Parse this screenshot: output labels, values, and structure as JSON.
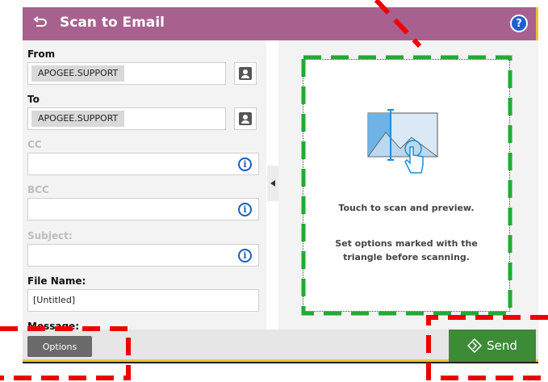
{
  "header": {
    "title": "Scan to Email",
    "help": "?"
  },
  "form": {
    "from_label": "From",
    "from_value": "APOGEE.SUPPORT",
    "to_label": "To",
    "to_value": "APOGEE.SUPPORT",
    "cc_label": "CC",
    "bcc_label": "BCC",
    "subject_label": "Subject:",
    "file_name_label": "File Name:",
    "file_name_value": "[Untitled]",
    "message_label": "Message:"
  },
  "preview": {
    "line1": "Touch to scan and preview.",
    "line2a": "Set options marked with the",
    "line2b": "triangle before scanning."
  },
  "footer": {
    "options_label": "Options",
    "send_label": "Send"
  },
  "colors": {
    "header": "#a8618f",
    "accent": "#f1c232",
    "send": "#3d8b37",
    "info": "#1a5fb4",
    "annotation_red": "#ee0000",
    "annotation_green": "#22aa33"
  },
  "icons": [
    "back-arrow-icon",
    "help-icon",
    "contact-book-icon",
    "info-icon",
    "collapse-arrow-icon",
    "scan-preview-icon",
    "send-diamond-icon"
  ]
}
